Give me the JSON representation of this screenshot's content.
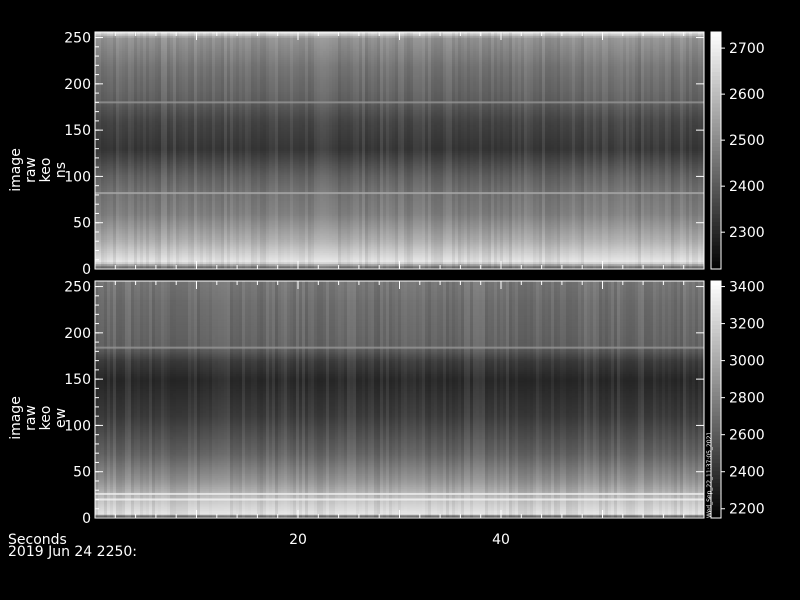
{
  "chart_data": [
    {
      "type": "heatmap",
      "ylabel_lines": [
        "image",
        "raw",
        "keo",
        "ns"
      ],
      "ylim": [
        0,
        256
      ],
      "xlim": [
        0,
        60
      ],
      "y_ticks": [
        0,
        50,
        100,
        150,
        200,
        250
      ],
      "colorbar": {
        "ticks": [
          2300,
          2400,
          2500,
          2600,
          2700
        ],
        "range": [
          2220,
          2735
        ]
      },
      "row_profile": [
        {
          "y": 0,
          "v": 2350
        },
        {
          "y": 8,
          "v": 2690
        },
        {
          "y": 30,
          "v": 2580
        },
        {
          "y": 60,
          "v": 2480
        },
        {
          "y": 80,
          "v": 2460
        },
        {
          "y": 100,
          "v": 2420
        },
        {
          "y": 130,
          "v": 2330
        },
        {
          "y": 160,
          "v": 2360
        },
        {
          "y": 185,
          "v": 2420
        },
        {
          "y": 220,
          "v": 2460
        },
        {
          "y": 250,
          "v": 2520
        },
        {
          "y": 256,
          "v": 2700
        }
      ],
      "bright_rows": [
        {
          "y": 82,
          "v": 2560
        },
        {
          "y": 180,
          "v": 2520
        }
      ]
    },
    {
      "type": "heatmap",
      "ylabel_lines": [
        "image",
        "raw",
        "keo",
        "ew"
      ],
      "ylim": [
        0,
        256
      ],
      "xlim": [
        0,
        60
      ],
      "y_ticks": [
        0,
        50,
        100,
        150,
        200,
        250
      ],
      "colorbar": {
        "ticks": [
          2200,
          2400,
          2600,
          2800,
          3000,
          3200,
          3400
        ],
        "range": [
          2150,
          3430
        ]
      },
      "row_profile": [
        {
          "y": 0,
          "v": 2200
        },
        {
          "y": 5,
          "v": 3300
        },
        {
          "y": 20,
          "v": 3150
        },
        {
          "y": 40,
          "v": 2900
        },
        {
          "y": 70,
          "v": 2650
        },
        {
          "y": 110,
          "v": 2450
        },
        {
          "y": 150,
          "v": 2350
        },
        {
          "y": 170,
          "v": 2450
        },
        {
          "y": 185,
          "v": 2650
        },
        {
          "y": 230,
          "v": 2700
        },
        {
          "y": 256,
          "v": 2750
        }
      ],
      "bright_rows": [
        {
          "y": 20,
          "v": 3380
        },
        {
          "y": 26,
          "v": 3350
        },
        {
          "y": 184,
          "v": 2900
        }
      ]
    }
  ],
  "x_axis": {
    "label": "Seconds",
    "ticks": [
      20,
      40
    ],
    "date_label": "2019 Jun 24 2250:"
  },
  "timestamp": "Wed_Sep_22_11:37:05_2021"
}
